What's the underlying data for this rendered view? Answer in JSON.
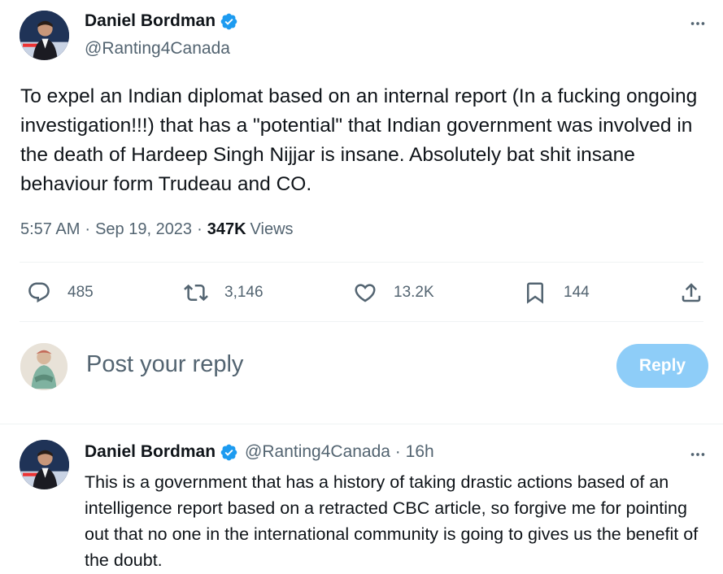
{
  "tweet": {
    "author_name": "Daniel Bordman",
    "author_handle": "@Ranting4Canada",
    "text": "To expel an Indian diplomat based on an internal report (In a fucking ongoing investigation!!!) that has a \"potential\" that Indian government was involved in the death of Hardeep Singh Nijjar is insane. Absolutely bat shit insane behaviour form Trudeau and CO.",
    "time": "5:57 AM",
    "date": "Sep 19, 2023",
    "views_count": "347K",
    "views_label": "Views",
    "separator": "·"
  },
  "actions": {
    "replies": "485",
    "retweets": "3,146",
    "likes": "13.2K",
    "bookmarks": "144"
  },
  "reply_box": {
    "placeholder": "Post your reply",
    "button_label": "Reply"
  },
  "reply_tweet": {
    "author_name": "Daniel Bordman",
    "handle_time": "@Ranting4Canada · 16h",
    "text": "This is a government that has a history of taking drastic actions based of an intelligence report based on a retracted CBC article, so forgive me for pointing out that no one in the international community is going to gives us the benefit of the doubt."
  },
  "colors": {
    "text": "#0f1419",
    "secondary": "#536471",
    "verified": "#1d9bf0",
    "reply_button": "#8ecdf8",
    "divider": "#eff3f4"
  },
  "icons": [
    "verified-badge-icon",
    "more-icon",
    "reply-icon",
    "retweet-icon",
    "like-icon",
    "bookmark-icon",
    "share-icon"
  ]
}
